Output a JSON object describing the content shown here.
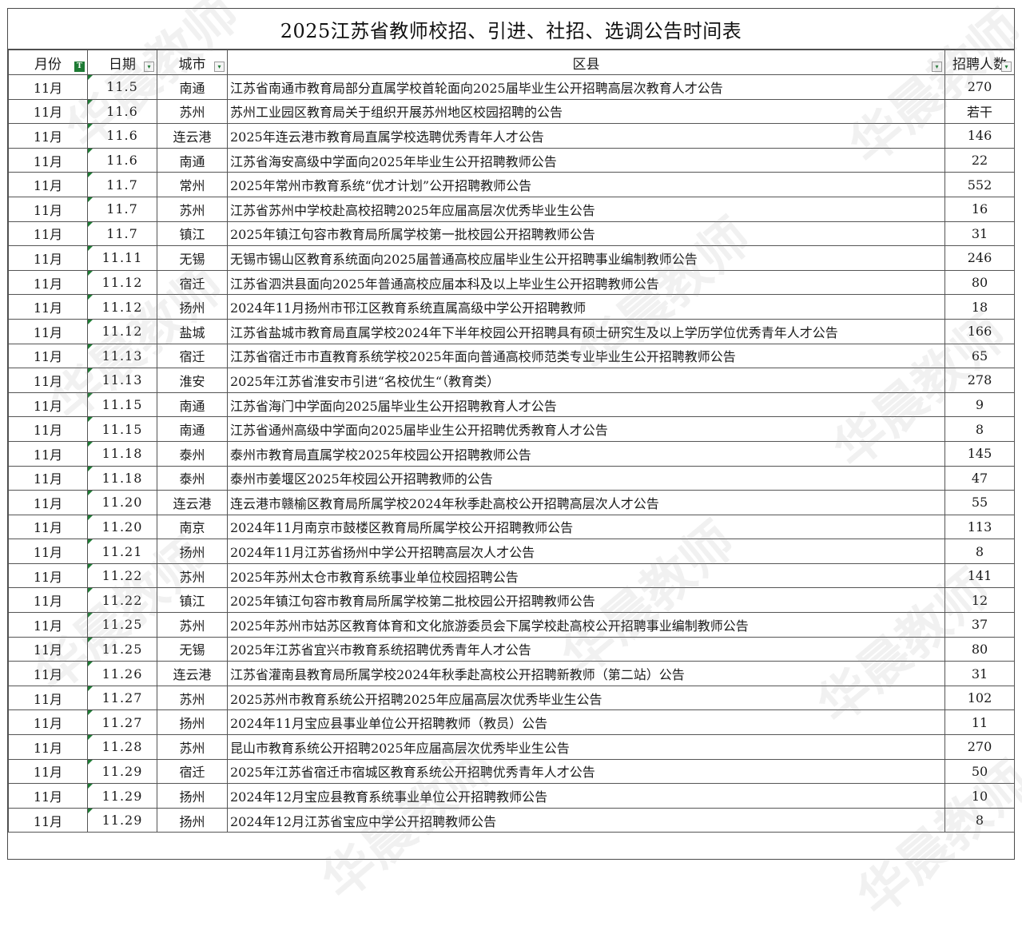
{
  "title": "2025江苏省教师校招、引进、社招、选调公告时间表",
  "headers": {
    "month": "月份",
    "date": "日期",
    "city": "城市",
    "desc": "区县",
    "count": "招聘人数"
  },
  "filter_icons": {
    "month": "T",
    "date": "▾",
    "city": "▾",
    "desc": "▾",
    "count": "▾"
  },
  "watermark": "华晨教师",
  "rows": [
    {
      "month": "11月",
      "date": "11.5",
      "city": "南通",
      "desc": "江苏省南通市教育局部分直属学校首轮面向2025届毕业生公开招聘高层次教育人才公告",
      "count": "270"
    },
    {
      "month": "11月",
      "date": "11.6",
      "city": "苏州",
      "desc": "苏州工业园区教育局关于组织开展苏州地区校园招聘的公告",
      "count": "若干"
    },
    {
      "month": "11月",
      "date": "11.6",
      "city": "连云港",
      "desc": "2025年连云港市教育局直属学校选聘优秀青年人才公告",
      "count": "146"
    },
    {
      "month": "11月",
      "date": "11.6",
      "city": "南通",
      "desc": "江苏省海安高级中学面向2025年毕业生公开招聘教师公告",
      "count": "22"
    },
    {
      "month": "11月",
      "date": "11.7",
      "city": "常州",
      "desc": "2025年常州市教育系统“优才计划”公开招聘教师公告",
      "count": "552"
    },
    {
      "month": "11月",
      "date": "11.7",
      "city": "苏州",
      "desc": "江苏省苏州中学校赴高校招聘2025年应届高层次优秀毕业生公告",
      "count": "16"
    },
    {
      "month": "11月",
      "date": "11.7",
      "city": "镇江",
      "desc": "2025年镇江句容市教育局所属学校第一批校园公开招聘教师公告",
      "count": "31"
    },
    {
      "month": "11月",
      "date": "11.11",
      "city": "无锡",
      "desc": "无锡市锡山区教育系统面向2025届普通高校应届毕业生公开招聘事业编制教师公告",
      "count": "246"
    },
    {
      "month": "11月",
      "date": "11.12",
      "city": "宿迁",
      "desc": "江苏省泗洪县面向2025年普通高校应届本科及以上毕业生公开招聘教师公告",
      "count": "80"
    },
    {
      "month": "11月",
      "date": "11.12",
      "city": "扬州",
      "desc": "2024年11月扬州市邗江区教育系统直属高级中学公开招聘教师",
      "count": "18"
    },
    {
      "month": "11月",
      "date": "11.12",
      "city": "盐城",
      "desc": "江苏省盐城市教育局直属学校2024年下半年校园公开招聘具有硕士研究生及以上学历学位优秀青年人才公告",
      "count": "166"
    },
    {
      "month": "11月",
      "date": "11.13",
      "city": "宿迁",
      "desc": "江苏省宿迁市市直教育系统学校2025年面向普通高校师范类专业毕业生公开招聘教师公告",
      "count": "65"
    },
    {
      "month": "11月",
      "date": "11.13",
      "city": "淮安",
      "desc": "2025年江苏省淮安市引进“名校优生“（教育类）",
      "count": "278"
    },
    {
      "month": "11月",
      "date": "11.15",
      "city": "南通",
      "desc": "江苏省海门中学面向2025届毕业生公开招聘教育人才公告",
      "count": "9"
    },
    {
      "month": "11月",
      "date": "11.15",
      "city": "南通",
      "desc": "江苏省通州高级中学面向2025届毕业生公开招聘优秀教育人才公告",
      "count": "8"
    },
    {
      "month": "11月",
      "date": "11.18",
      "city": "泰州",
      "desc": "泰州市教育局直属学校2025年校园公开招聘教师公告",
      "count": "145"
    },
    {
      "month": "11月",
      "date": "11.18",
      "city": "泰州",
      "desc": "泰州市姜堰区2025年校园公开招聘教师的公告",
      "count": "47"
    },
    {
      "month": "11月",
      "date": "11.20",
      "city": "连云港",
      "desc": "连云港市赣榆区教育局所属学校2024年秋季赴高校公开招聘高层次人才公告",
      "count": "55"
    },
    {
      "month": "11月",
      "date": "11.20",
      "city": "南京",
      "desc": "2024年11月南京市鼓楼区教育局所属学校公开招聘教师公告",
      "count": "113"
    },
    {
      "month": "11月",
      "date": "11.21",
      "city": "扬州",
      "desc": "2024年11月江苏省扬州中学公开招聘高层次人才公告",
      "count": "8"
    },
    {
      "month": "11月",
      "date": "11.22",
      "city": "苏州",
      "desc": "2025年苏州太仓市教育系统事业单位校园招聘公告",
      "count": "141"
    },
    {
      "month": "11月",
      "date": "11.22",
      "city": "镇江",
      "desc": "2025年镇江句容市教育局所属学校第二批校园公开招聘教师公告",
      "count": "12"
    },
    {
      "month": "11月",
      "date": "11.25",
      "city": "苏州",
      "desc": "2025年苏州市姑苏区教育体育和文化旅游委员会下属学校赴高校公开招聘事业编制教师公告",
      "count": "37"
    },
    {
      "month": "11月",
      "date": "11.25",
      "city": "无锡",
      "desc": "2025年江苏省宜兴市教育系统招聘优秀青年人才公告",
      "count": "80"
    },
    {
      "month": "11月",
      "date": "11.26",
      "city": "连云港",
      "desc": "江苏省灌南县教育局所属学校2024年秋季赴高校公开招聘新教师（第二站）公告",
      "count": "31"
    },
    {
      "month": "11月",
      "date": "11.27",
      "city": "苏州",
      "desc": "2025苏州市教育系统公开招聘2025年应届高层次优秀毕业生公告",
      "count": "102"
    },
    {
      "month": "11月",
      "date": "11.27",
      "city": "扬州",
      "desc": "2024年11月宝应县事业单位公开招聘教师（教员）公告",
      "count": "11"
    },
    {
      "month": "11月",
      "date": "11.28",
      "city": "苏州",
      "desc": "昆山市教育系统公开招聘2025年应届高层次优秀毕业生公告",
      "count": "270"
    },
    {
      "month": "11月",
      "date": "11.29",
      "city": "宿迁",
      "desc": "2025年江苏省宿迁市宿城区教育系统公开招聘优秀青年人才公告",
      "count": "50"
    },
    {
      "month": "11月",
      "date": "11.29",
      "city": "扬州",
      "desc": "2024年12月宝应县教育系统事业单位公开招聘教师公告",
      "count": "10"
    },
    {
      "month": "11月",
      "date": "11.29",
      "city": "扬州",
      "desc": "2024年12月江苏省宝应中学公开招聘教师公告",
      "count": "8"
    }
  ]
}
